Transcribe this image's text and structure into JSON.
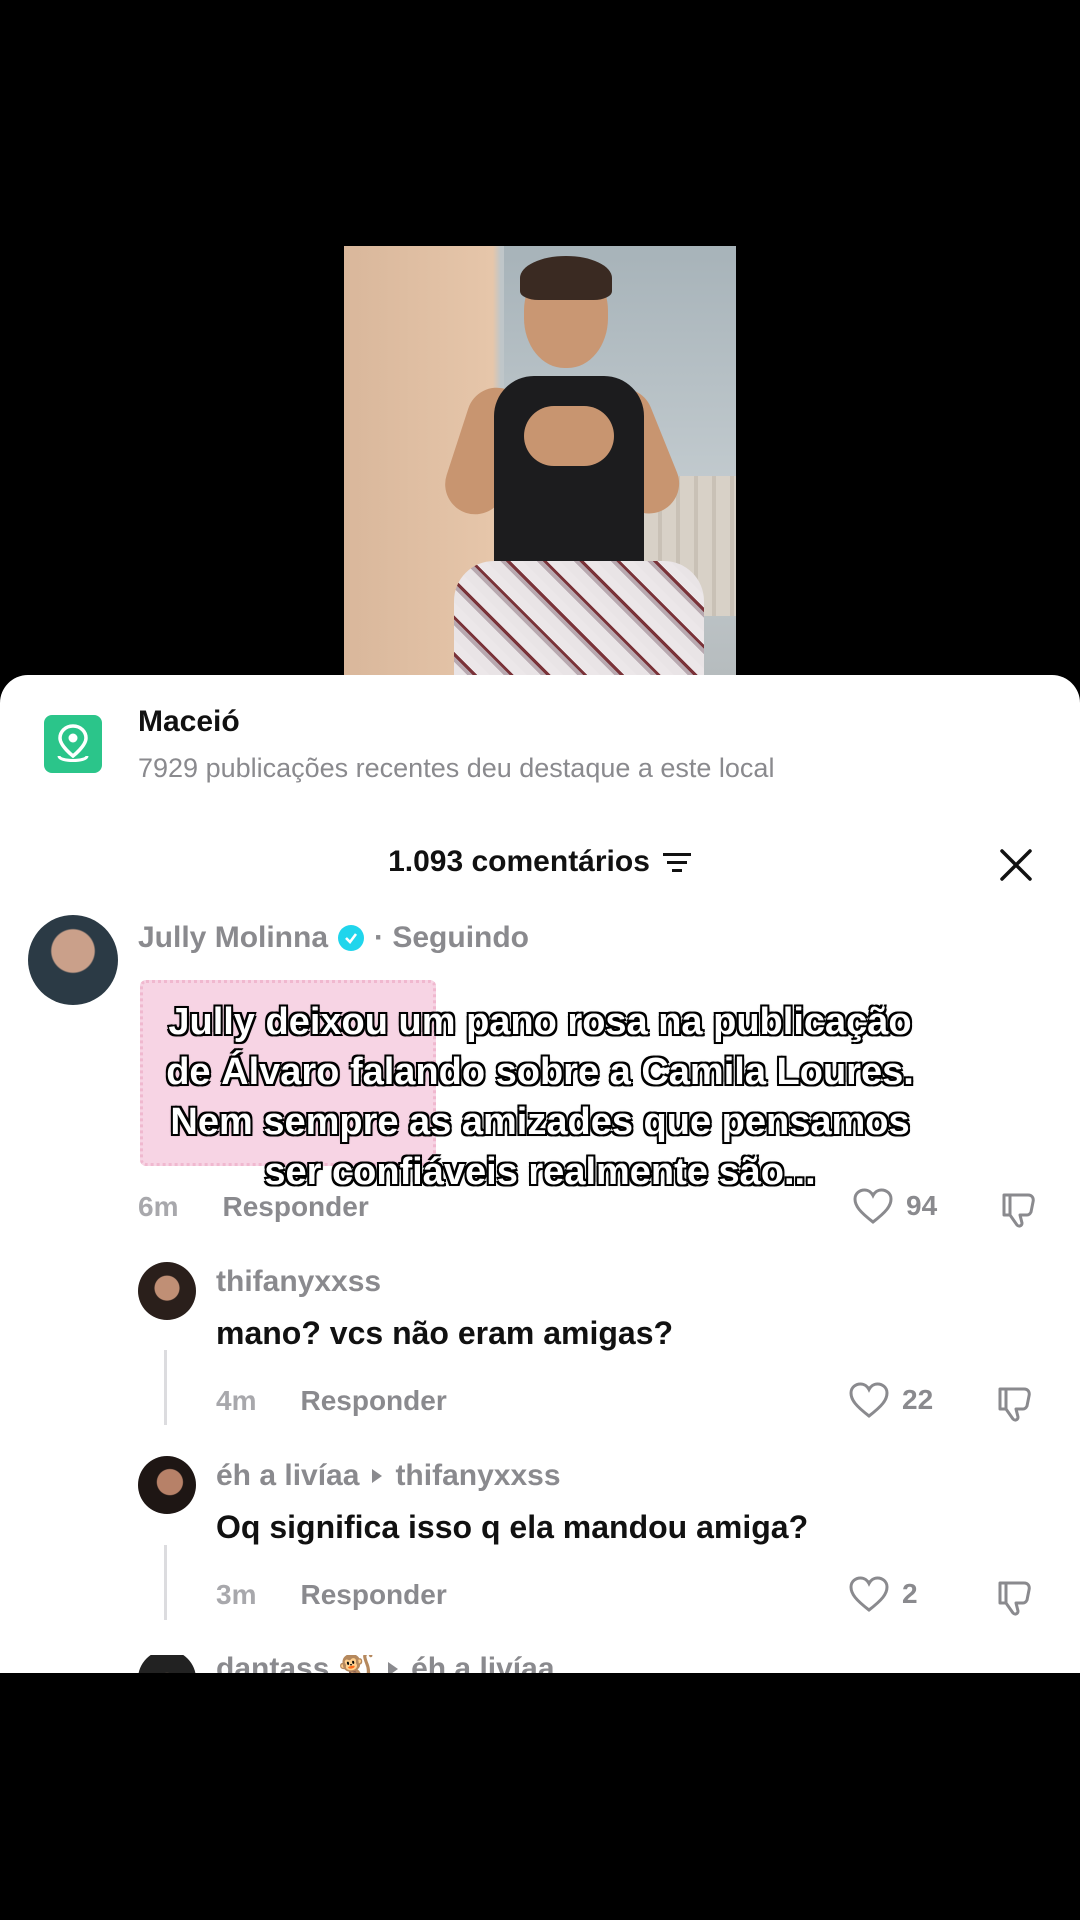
{
  "location": {
    "name": "Maceió",
    "subtitle": "7929 publicações recentes deu destaque a este local",
    "icon": "map-pin-icon",
    "icon_color": "#2bc58a"
  },
  "comments_header": {
    "count_label": "1.093 comentários",
    "filter_icon": "filter-icon",
    "close_icon": "close-icon"
  },
  "overlay_caption": [
    "Jully deixou um pano rosa na publicação",
    "de Álvaro falando sobre a Camila Loures.",
    "Nem sempre as amizades que pensamos",
    "ser confiáveis realmente são..."
  ],
  "comments": [
    {
      "user": "Jully Molinna",
      "verified": true,
      "relation": "· Seguindo",
      "time": "6m",
      "reply_label": "Responder",
      "likes": "94"
    },
    {
      "user": "thifanyxxss",
      "text": "mano? vcs não eram amigas?",
      "time": "4m",
      "reply_label": "Responder",
      "likes": "22"
    },
    {
      "user": "éh a livíaa",
      "reply_to": "thifanyxxss",
      "text": "Oq significa isso q ela mandou amiga?",
      "time": "3m",
      "reply_label": "Responder",
      "likes": "2"
    },
    {
      "user": "dantass 🐒",
      "reply_to": "éh a livíaa"
    }
  ]
}
